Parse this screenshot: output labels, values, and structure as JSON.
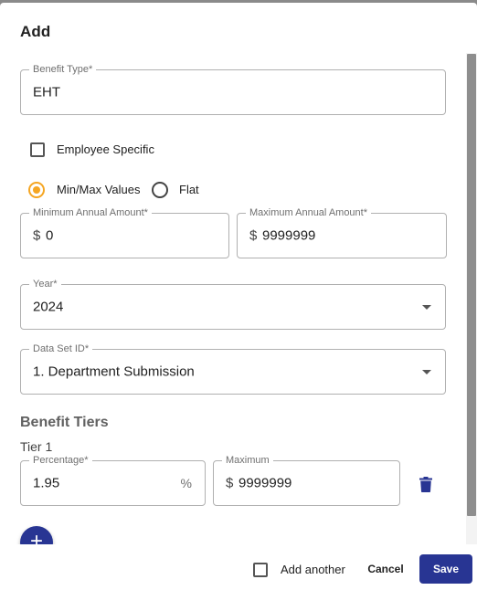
{
  "dialog": {
    "title": "Add"
  },
  "form": {
    "benefit_type": {
      "label": "Benefit Type*",
      "value": "EHT"
    },
    "employee_specific": {
      "label": "Employee Specific",
      "checked": false
    },
    "value_mode": {
      "options": [
        {
          "label": "Min/Max Values",
          "selected": true
        },
        {
          "label": "Flat",
          "selected": false
        }
      ]
    },
    "min_annual": {
      "label": "Minimum Annual Amount*",
      "prefix": "$",
      "value": "0"
    },
    "max_annual": {
      "label": "Maximum Annual Amount*",
      "prefix": "$",
      "value": "9999999"
    },
    "year": {
      "label": "Year*",
      "value": "2024"
    },
    "data_set": {
      "label": "Data Set ID*",
      "value": "1. Department Submission"
    }
  },
  "tiers": {
    "section_title": "Benefit Tiers",
    "items": [
      {
        "label": "Tier 1",
        "percentage": {
          "label": "Percentage*",
          "value": "1.95",
          "suffix": "%"
        },
        "maximum": {
          "label": "Maximum",
          "prefix": "$",
          "value": "9999999"
        },
        "delete_icon": "trash-icon"
      }
    ],
    "add_icon": "plus-icon",
    "add_glyph": "+"
  },
  "footer": {
    "add_another": {
      "label": "Add another",
      "checked": false
    },
    "cancel_label": "Cancel",
    "save_label": "Save"
  },
  "colors": {
    "primary": "#283593",
    "radio_accent": "#f5a623"
  }
}
